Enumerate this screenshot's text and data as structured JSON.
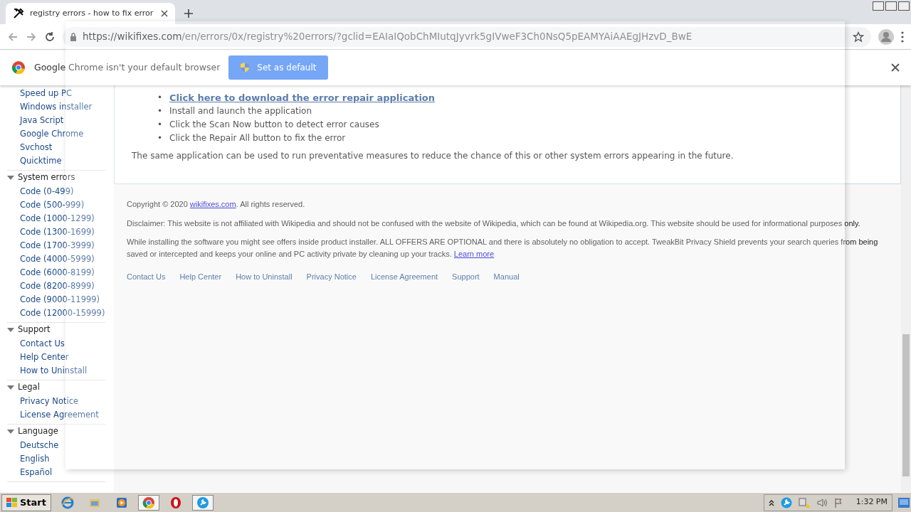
{
  "browser": {
    "tab": {
      "title": "registry errors - how to fix error",
      "selected": true
    },
    "url": {
      "host": "https://wikifixes.com",
      "path": "/en/errors/0x/registry%20errors/?gclid=EAIaIQobChMIutqJyvrk5gIVweF3Ch0NsQ5pEAMYAiAAEgJHzvD_BwE"
    },
    "infobar": {
      "message": "Google Chrome isn't your default browser",
      "button": "Set as default"
    }
  },
  "sidebar": {
    "groups": [
      {
        "items": [
          "Speed up PC",
          "Windows installer",
          "Java Script",
          "Google Chrome",
          "Svchost",
          "Quicktime"
        ]
      },
      {
        "title": "System errors",
        "expanded": true,
        "items": [
          "Code (0-499)",
          "Code (500-999)",
          "Code (1000-1299)",
          "Code (1300-1699)",
          "Code (1700-3999)",
          "Code (4000-5999)",
          "Code (6000-8199)",
          "Code (8200-8999)",
          "Code (9000-11999)",
          "Code (12000-15999)"
        ]
      },
      {
        "title": "Support",
        "expanded": true,
        "items": [
          "Contact Us",
          "Help Center",
          "How to Uninstall"
        ]
      },
      {
        "title": "Legal",
        "expanded": true,
        "items": [
          "Privacy Notice",
          "License Agreement"
        ]
      },
      {
        "title": "Language",
        "expanded": true,
        "items": [
          "Deutsche",
          "English",
          "Español"
        ]
      }
    ]
  },
  "steps": [
    {
      "kind": "link",
      "marker": "•",
      "text": "Click here to download the error repair application"
    },
    {
      "kind": "text",
      "marker": "•",
      "text": "Install and launch the application"
    },
    {
      "kind": "text",
      "marker": "•",
      "text": "Click the Scan Now button to detect error causes"
    },
    {
      "kind": "text",
      "marker": "•",
      "text": "Click the Repair All button to fix the error"
    }
  ],
  "note": "The same application can be used to run preventative measures to reduce the chance of this or other system errors appearing in the future.",
  "footer": {
    "copyright": {
      "before": "Copyright © 2020 ",
      "link": "wikifixes.com",
      "after": ". All rights reserved."
    },
    "disclaimer": "Disclaimer: This website is not affiliated with Wikipedia and should not be confused with the website of Wikipedia, which can be found at Wikipedia.org. This website should be used for informational purposes only.",
    "offers": {
      "text": "While installing the software you might see offers inside product installer. ALL OFFERS ARE OPTIONAL and there is absolutely no obligation to accept. TweakBit Privacy Shield prevents your search queries from being saved or intercepted and keeps your online and PC activity private by cleaning up your tracks.",
      "link": "Learn more"
    },
    "links": [
      "Contact Us",
      "Help Center",
      "How to Uninstall",
      "Privacy Notice",
      "License Agreement",
      "Support",
      "Manual"
    ]
  },
  "taskbar": {
    "start": "Start",
    "apps": [
      {
        "kind": "ie",
        "active": false
      },
      {
        "kind": "folder",
        "active": false
      },
      {
        "kind": "media",
        "active": false
      },
      {
        "kind": "chrome",
        "active": true
      },
      {
        "kind": "opera",
        "active": false
      },
      {
        "kind": "tool",
        "active": true
      }
    ],
    "clock": "1:32 PM"
  }
}
